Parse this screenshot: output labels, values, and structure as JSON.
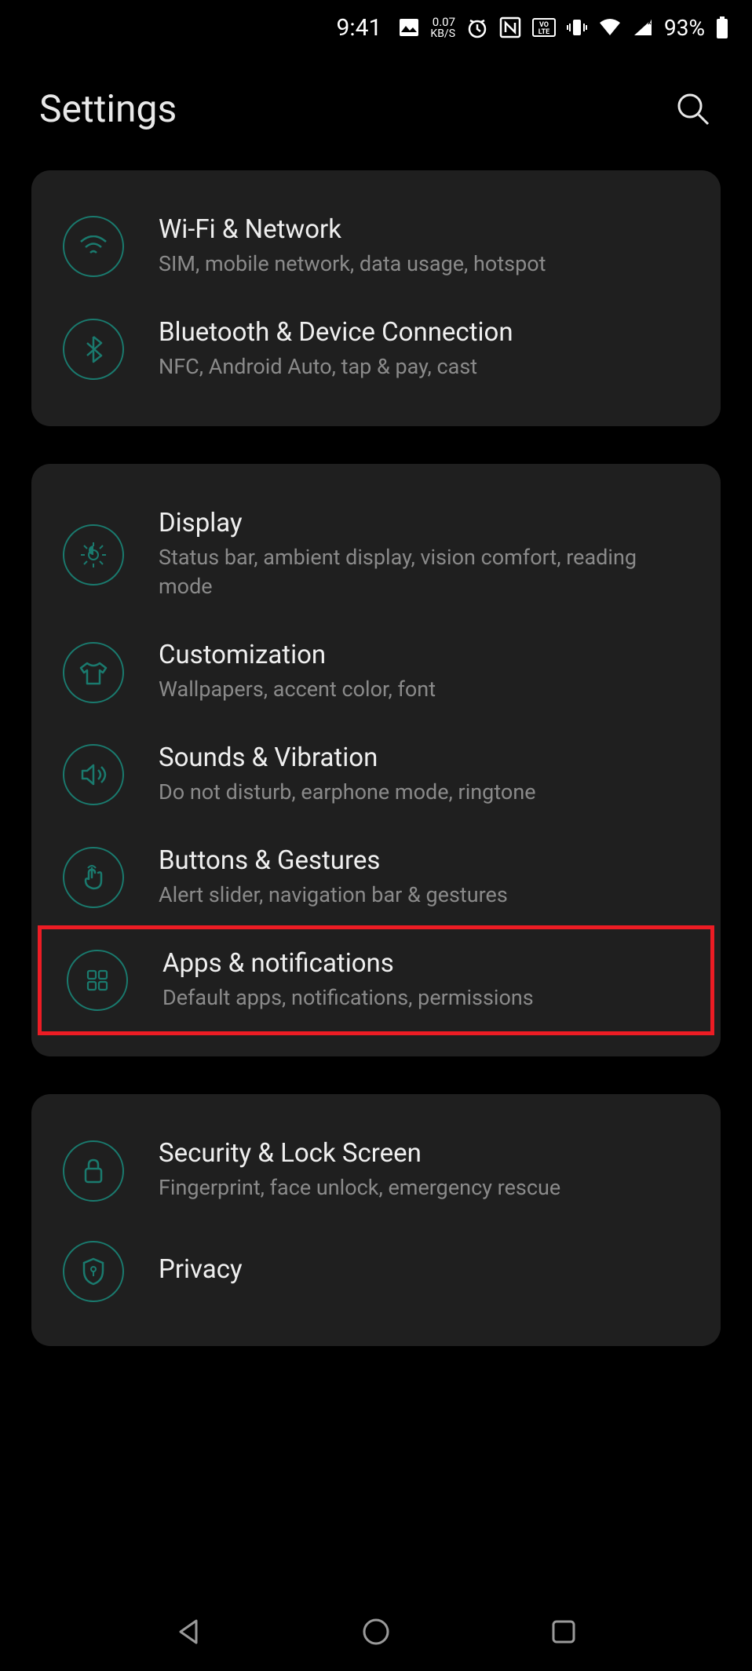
{
  "status": {
    "time": "9:41",
    "kbs_value": "0.07",
    "kbs_unit": "KB/S",
    "battery_pct": "93%"
  },
  "header": {
    "title": "Settings"
  },
  "groups": [
    {
      "items": [
        {
          "icon": "wifi",
          "title": "Wi-Fi & Network",
          "sub": "SIM, mobile network, data usage, hotspot"
        },
        {
          "icon": "bluetooth",
          "title": "Bluetooth & Device Connection",
          "sub": "NFC, Android Auto, tap & pay, cast"
        }
      ]
    },
    {
      "items": [
        {
          "icon": "display",
          "title": "Display",
          "sub": "Status bar, ambient display, vision comfort, reading mode"
        },
        {
          "icon": "customization",
          "title": "Customization",
          "sub": "Wallpapers, accent color, font"
        },
        {
          "icon": "sound",
          "title": "Sounds & Vibration",
          "sub": "Do not disturb, earphone mode, ringtone"
        },
        {
          "icon": "gesture",
          "title": "Buttons & Gestures",
          "sub": "Alert slider, navigation bar & gestures"
        },
        {
          "icon": "apps",
          "title": "Apps & notifications",
          "sub": "Default apps, notifications, permissions",
          "highlight": true
        }
      ]
    },
    {
      "items": [
        {
          "icon": "lock",
          "title": "Security & Lock Screen",
          "sub": "Fingerprint, face unlock, emergency rescue"
        },
        {
          "icon": "privacy",
          "title": "Privacy",
          "sub": ""
        }
      ]
    }
  ]
}
